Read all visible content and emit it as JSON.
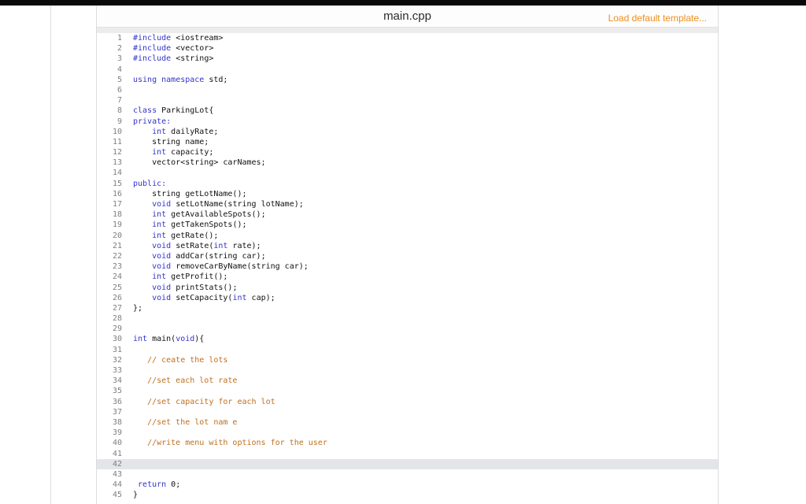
{
  "colors": {
    "topbar": "#0a0a0a",
    "keyword": "#3333cc",
    "comment": "#bf6f1f",
    "code": "#111111",
    "gutter": "#7f7f7f",
    "accent": "#ef8e1d",
    "active-line": "#e3e5e8"
  },
  "header": {
    "filename": "main.cpp",
    "load_template_label": "Load default template..."
  },
  "editor": {
    "active_line": 42,
    "lines": [
      {
        "n": 1,
        "s": [
          {
            "t": "#include",
            "c": "k"
          },
          {
            "t": " <iostream>",
            "c": "p"
          }
        ]
      },
      {
        "n": 2,
        "s": [
          {
            "t": "#include",
            "c": "k"
          },
          {
            "t": " <vector>",
            "c": "p"
          }
        ]
      },
      {
        "n": 3,
        "s": [
          {
            "t": "#include",
            "c": "k"
          },
          {
            "t": " <string>",
            "c": "p"
          }
        ]
      },
      {
        "n": 4,
        "s": []
      },
      {
        "n": 5,
        "s": [
          {
            "t": "using",
            "c": "k"
          },
          {
            "t": " ",
            "c": "p"
          },
          {
            "t": "namespace",
            "c": "k"
          },
          {
            "t": " std;",
            "c": "p"
          }
        ]
      },
      {
        "n": 6,
        "s": []
      },
      {
        "n": 7,
        "s": []
      },
      {
        "n": 8,
        "s": [
          {
            "t": "class",
            "c": "k"
          },
          {
            "t": " ParkingLot{",
            "c": "p"
          }
        ]
      },
      {
        "n": 9,
        "s": [
          {
            "t": "private:",
            "c": "k"
          }
        ]
      },
      {
        "n": 10,
        "s": [
          {
            "t": "    ",
            "c": "p"
          },
          {
            "t": "int",
            "c": "k"
          },
          {
            "t": " dailyRate;",
            "c": "p"
          }
        ]
      },
      {
        "n": 11,
        "s": [
          {
            "t": "    string name;",
            "c": "p"
          }
        ]
      },
      {
        "n": 12,
        "s": [
          {
            "t": "    ",
            "c": "p"
          },
          {
            "t": "int",
            "c": "k"
          },
          {
            "t": " capacity;",
            "c": "p"
          }
        ]
      },
      {
        "n": 13,
        "s": [
          {
            "t": "    vector<string> carNames;",
            "c": "p"
          }
        ]
      },
      {
        "n": 14,
        "s": []
      },
      {
        "n": 15,
        "s": [
          {
            "t": "public:",
            "c": "k"
          }
        ]
      },
      {
        "n": 16,
        "s": [
          {
            "t": "    string getLotName();",
            "c": "p"
          }
        ]
      },
      {
        "n": 17,
        "s": [
          {
            "t": "    ",
            "c": "p"
          },
          {
            "t": "void",
            "c": "k"
          },
          {
            "t": " setLotName(string lotName);",
            "c": "p"
          }
        ]
      },
      {
        "n": 18,
        "s": [
          {
            "t": "    ",
            "c": "p"
          },
          {
            "t": "int",
            "c": "k"
          },
          {
            "t": " getAvailableSpots();",
            "c": "p"
          }
        ]
      },
      {
        "n": 19,
        "s": [
          {
            "t": "    ",
            "c": "p"
          },
          {
            "t": "int",
            "c": "k"
          },
          {
            "t": " getTakenSpots();",
            "c": "p"
          }
        ]
      },
      {
        "n": 20,
        "s": [
          {
            "t": "    ",
            "c": "p"
          },
          {
            "t": "int",
            "c": "k"
          },
          {
            "t": " getRate();",
            "c": "p"
          }
        ]
      },
      {
        "n": 21,
        "s": [
          {
            "t": "    ",
            "c": "p"
          },
          {
            "t": "void",
            "c": "k"
          },
          {
            "t": " setRate(",
            "c": "p"
          },
          {
            "t": "int",
            "c": "k"
          },
          {
            "t": " rate);",
            "c": "p"
          }
        ]
      },
      {
        "n": 22,
        "s": [
          {
            "t": "    ",
            "c": "p"
          },
          {
            "t": "void",
            "c": "k"
          },
          {
            "t": " addCar(string car);",
            "c": "p"
          }
        ]
      },
      {
        "n": 23,
        "s": [
          {
            "t": "    ",
            "c": "p"
          },
          {
            "t": "void",
            "c": "k"
          },
          {
            "t": " removeCarByName(string car);",
            "c": "p"
          }
        ]
      },
      {
        "n": 24,
        "s": [
          {
            "t": "    ",
            "c": "p"
          },
          {
            "t": "int",
            "c": "k"
          },
          {
            "t": " getProfit();",
            "c": "p"
          }
        ]
      },
      {
        "n": 25,
        "s": [
          {
            "t": "    ",
            "c": "p"
          },
          {
            "t": "void",
            "c": "k"
          },
          {
            "t": " printStats();",
            "c": "p"
          }
        ]
      },
      {
        "n": 26,
        "s": [
          {
            "t": "    ",
            "c": "p"
          },
          {
            "t": "void",
            "c": "k"
          },
          {
            "t": " setCapacity(",
            "c": "p"
          },
          {
            "t": "int",
            "c": "k"
          },
          {
            "t": " cap);",
            "c": "p"
          }
        ]
      },
      {
        "n": 27,
        "s": [
          {
            "t": "};",
            "c": "p"
          }
        ]
      },
      {
        "n": 28,
        "s": []
      },
      {
        "n": 29,
        "s": []
      },
      {
        "n": 30,
        "s": [
          {
            "t": "int",
            "c": "k"
          },
          {
            "t": " main(",
            "c": "p"
          },
          {
            "t": "void",
            "c": "k"
          },
          {
            "t": "){",
            "c": "p"
          }
        ]
      },
      {
        "n": 31,
        "s": []
      },
      {
        "n": 32,
        "s": [
          {
            "t": "   ",
            "c": "p"
          },
          {
            "t": "// ceate the lots",
            "c": "c"
          }
        ]
      },
      {
        "n": 33,
        "s": []
      },
      {
        "n": 34,
        "s": [
          {
            "t": "   ",
            "c": "p"
          },
          {
            "t": "//set each lot rate",
            "c": "c"
          }
        ]
      },
      {
        "n": 35,
        "s": []
      },
      {
        "n": 36,
        "s": [
          {
            "t": "   ",
            "c": "p"
          },
          {
            "t": "//set capacity for each lot",
            "c": "c"
          }
        ]
      },
      {
        "n": 37,
        "s": []
      },
      {
        "n": 38,
        "s": [
          {
            "t": "   ",
            "c": "p"
          },
          {
            "t": "//set the lot nam e",
            "c": "c"
          }
        ]
      },
      {
        "n": 39,
        "s": []
      },
      {
        "n": 40,
        "s": [
          {
            "t": "   ",
            "c": "p"
          },
          {
            "t": "//write menu with options for the user",
            "c": "c"
          }
        ]
      },
      {
        "n": 41,
        "s": []
      },
      {
        "n": 42,
        "s": []
      },
      {
        "n": 43,
        "s": []
      },
      {
        "n": 44,
        "s": [
          {
            "t": " ",
            "c": "p"
          },
          {
            "t": "return",
            "c": "k"
          },
          {
            "t": " 0;",
            "c": "p"
          }
        ]
      },
      {
        "n": 45,
        "s": [
          {
            "t": "}",
            "c": "p"
          }
        ]
      }
    ]
  }
}
